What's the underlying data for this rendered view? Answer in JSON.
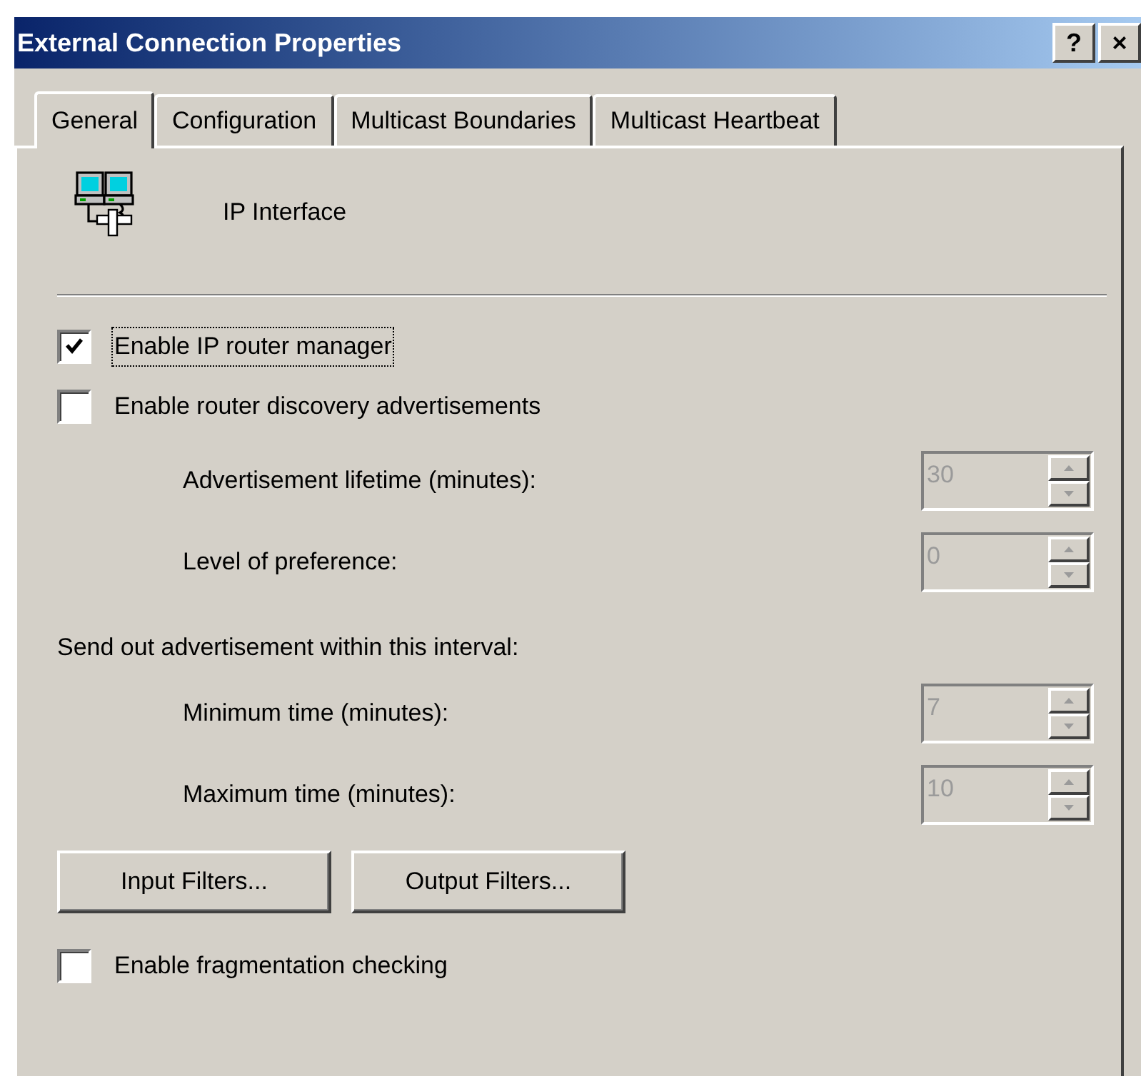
{
  "window": {
    "title": "External Connection Properties",
    "title_buttons": [
      "?",
      "×"
    ]
  },
  "tabs": [
    {
      "label": "General",
      "selected": true
    },
    {
      "label": "Configuration",
      "selected": false
    },
    {
      "label": "Multicast Boundaries",
      "selected": false
    },
    {
      "label": "Multicast Heartbeat",
      "selected": false
    }
  ],
  "header": {
    "label": "IP Interface"
  },
  "options": [
    {
      "label": "Enable IP router manager",
      "checked": true,
      "focused": true
    },
    {
      "label": "Enable router discovery advertisements",
      "checked": false,
      "focused": false
    }
  ],
  "advertisement_fields": [
    {
      "label": "Advertisement lifetime (minutes):",
      "value": "30",
      "disabled": true
    },
    {
      "label": "Level of preference:",
      "value": "0",
      "disabled": true
    }
  ],
  "interval": {
    "label": "Send out advertisement within this interval:",
    "fields": [
      {
        "label": "Minimum time (minutes):",
        "value": "7",
        "disabled": true
      },
      {
        "label": "Maximum time (minutes):",
        "value": "10",
        "disabled": true
      }
    ]
  },
  "buttons": [
    "Input Filters...",
    "Output Filters..."
  ],
  "fragmentation": {
    "label": "Enable fragmentation checking",
    "checked": false,
    "focused": false
  }
}
